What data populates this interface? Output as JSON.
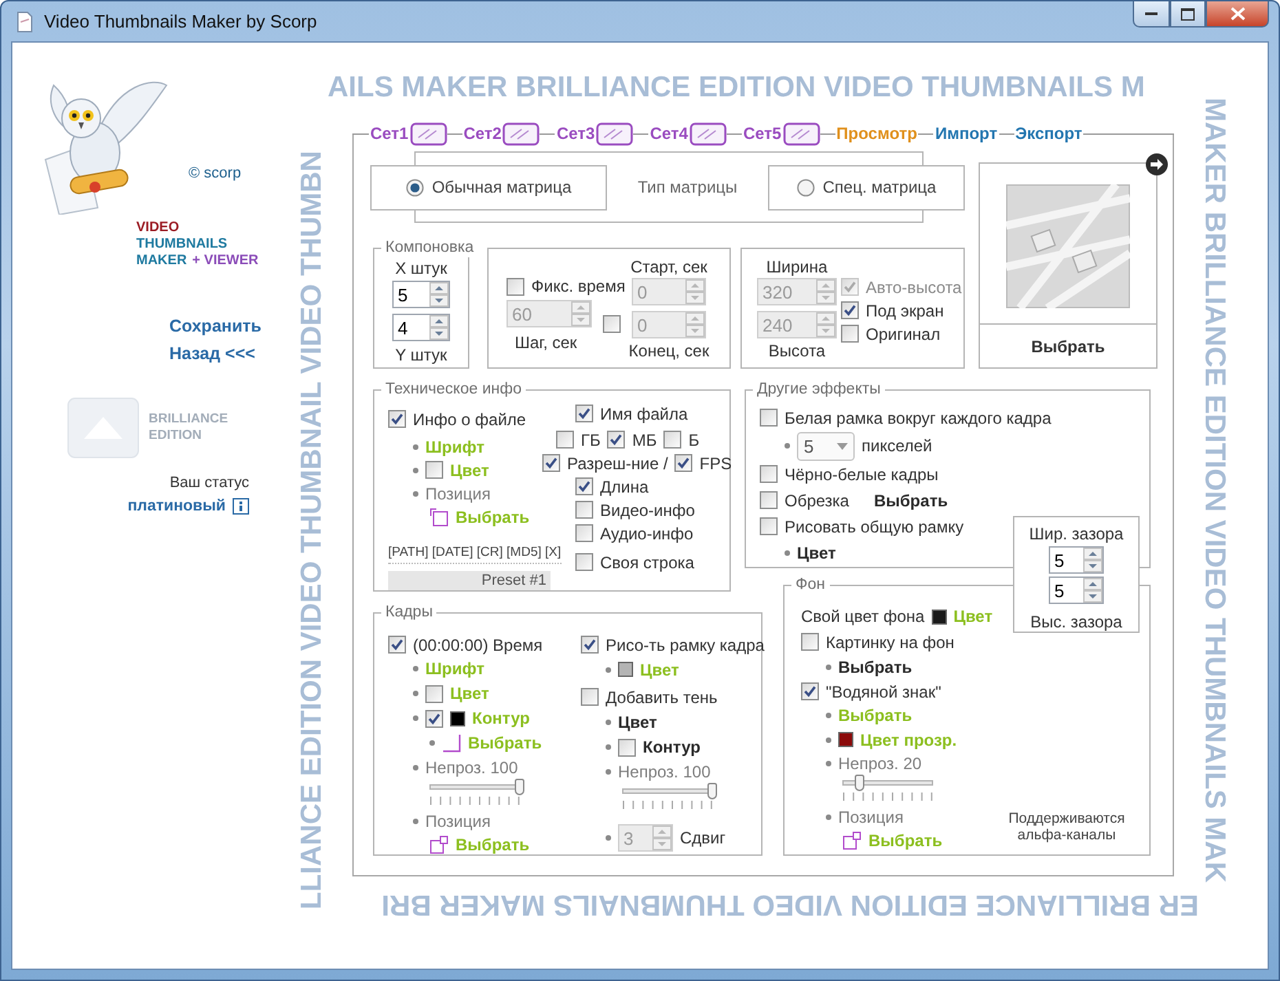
{
  "window": {
    "title": "Video Thumbnails Maker by Scorp"
  },
  "backdrop": {
    "top": "AILS MAKER BRILLIANCE EDITION VIDEO THUMBNAILS M",
    "right": "MAKER BRILLIANCE EDITION VIDEO THUMBNAILS MAK",
    "bottom": "ER BRILLIANCE EDITION VIDEO THUMBNAILS MAKER BRI",
    "left": "LLIANCE EDITION VIDEO THUMBNAIL VIDEO THUMBN"
  },
  "sidebar": {
    "copyright": "© scorp",
    "logo": {
      "line_1": "VIDEO",
      "line_2": "THUMBNAILS",
      "line_3": "MAKER",
      "line_3_extra": "+ VIEWER"
    },
    "links": [
      "Сохранить",
      "Назад <<<"
    ],
    "edition": [
      "BRILLIANCE",
      "EDITION"
    ],
    "status_label": "Ваш статус",
    "status_value": "платиновый"
  },
  "tabs": [
    {
      "label": "Сет1",
      "kind": "set"
    },
    {
      "label": "Сет2",
      "kind": "set"
    },
    {
      "label": "Сет3",
      "kind": "set"
    },
    {
      "label": "Сет4",
      "kind": "set"
    },
    {
      "label": "Сет5",
      "kind": "set"
    },
    {
      "label": "Просмотр",
      "kind": "preview"
    },
    {
      "label": "Импорт",
      "kind": "io"
    },
    {
      "label": "Экспорт",
      "kind": "io"
    }
  ],
  "matrix": {
    "title": "Тип матрицы",
    "options": [
      {
        "label": "Обычная матрица",
        "selected": true
      },
      {
        "label": "Спец. матрица",
        "selected": false
      }
    ]
  },
  "layout_group": {
    "legend": "Компоновка",
    "x_label": "X штук",
    "x_value": "5",
    "y_value": "4",
    "y_label": "Y штук"
  },
  "time_group": {
    "fixed_time": {
      "label": "Фикс. время",
      "checked": false
    },
    "step_value": "60",
    "step_label": "Шаг, сек",
    "start_label": "Старт, сек",
    "start_value": "0",
    "range": {
      "checked": false
    },
    "end_value": "0",
    "end_label": "Конец, сек"
  },
  "size_group": {
    "width_label": "Ширина",
    "width_value": "320",
    "height_value": "240",
    "height_label": "Высота",
    "fields_disabled": true,
    "options": [
      {
        "label": "Авто-высота",
        "checked": true,
        "disabled": true
      },
      {
        "label": "Под экран",
        "checked": true,
        "disabled": false
      },
      {
        "label": "Оригинал",
        "checked": false,
        "disabled": false
      }
    ]
  },
  "preview": {
    "button": "Выбрать"
  },
  "tech_info": {
    "legend": "Техническое инфо",
    "file_info": {
      "label": "Инфо о файле",
      "checked": true
    },
    "font": "Шрифт",
    "color": {
      "label": "Цвет",
      "checked": false
    },
    "position_label": "Позиция",
    "position_pick": "Выбрать",
    "tags": "[PATH] [DATE] [CR] [MD5] [X]",
    "preset": "Preset #1",
    "file_name": {
      "label": "Имя файла",
      "checked": true
    },
    "units": [
      {
        "label": "ГБ",
        "checked": false
      },
      {
        "label": "МБ",
        "checked": true
      },
      {
        "label": "Б",
        "checked": false
      }
    ],
    "resolution": {
      "label": "Разреш-ние /",
      "checked": true
    },
    "fps": {
      "label": "FPS",
      "checked": true
    },
    "extras": [
      {
        "label": "Длина",
        "checked": true
      },
      {
        "label": "Видео-инфо",
        "checked": false
      },
      {
        "label": "Аудио-инфо",
        "checked": false
      }
    ],
    "custom_line": {
      "label": "Своя строка",
      "checked": false
    }
  },
  "other_effects": {
    "legend": "Другие эффекты",
    "white_frame": {
      "label": "Белая рамка вокруг каждого кадра",
      "checked": false
    },
    "frame_pixels": "5",
    "pixels_unit": "пикселей",
    "grayscale": {
      "label": "Чёрно-белые кадры",
      "checked": false
    },
    "crop": {
      "label": "Обрезка",
      "checked": false
    },
    "crop_pick": "Выбрать",
    "common_frame": {
      "label": "Рисовать общую рамку",
      "checked": false
    },
    "common_frame_color": "Цвет"
  },
  "gap": {
    "width_label": "Шир. зазора",
    "width_value": "5",
    "height_value": "5",
    "height_label": "Выс. зазора"
  },
  "frames": {
    "legend": "Кадры",
    "time": {
      "label": "(00:00:00) Время",
      "checked": true
    },
    "font": "Шрифт",
    "color": {
      "label": "Цвет",
      "checked": false
    },
    "outline": {
      "label": "Контур",
      "checked": true,
      "color": "#000000"
    },
    "outline_pick": "Выбрать",
    "opacity": {
      "label": "Непроз. 100",
      "level": 1
    },
    "position_label": "Позиция",
    "position_pick": "Выбрать",
    "border": {
      "label": "Рисо-ть рамку кадра",
      "checked": true,
      "color": "#b4b4b4"
    },
    "border_color": "Цвет",
    "shadow": {
      "label": "Добавить тень",
      "checked": false
    },
    "shadow_color": "Цвет",
    "shadow_outline": {
      "label": "Контур",
      "checked": false
    },
    "shadow_opacity": {
      "label": "Непроз. 100",
      "level": 1
    },
    "shift_value": "3",
    "shift_label": "Сдвиг"
  },
  "background": {
    "legend": "Фон",
    "own_color_label": "Свой цвет фона",
    "own_color": {
      "label": "Цвет",
      "color": "#1a1a1a"
    },
    "picture": {
      "label": "Картинку на фон",
      "checked": false
    },
    "picture_pick": "Выбрать",
    "watermark": {
      "label": "\"Водяной знак\"",
      "checked": true
    },
    "watermark_pick": "Выбрать",
    "transparent_color": {
      "label": "Цвет прозр.",
      "color": "#8b0a0a"
    },
    "opacity": {
      "label": "Непроз. 20",
      "level": 0.2
    },
    "position_label": "Позиция",
    "position_pick": "Выбрать",
    "note": "Поддерживаются альфа-каналы"
  }
}
